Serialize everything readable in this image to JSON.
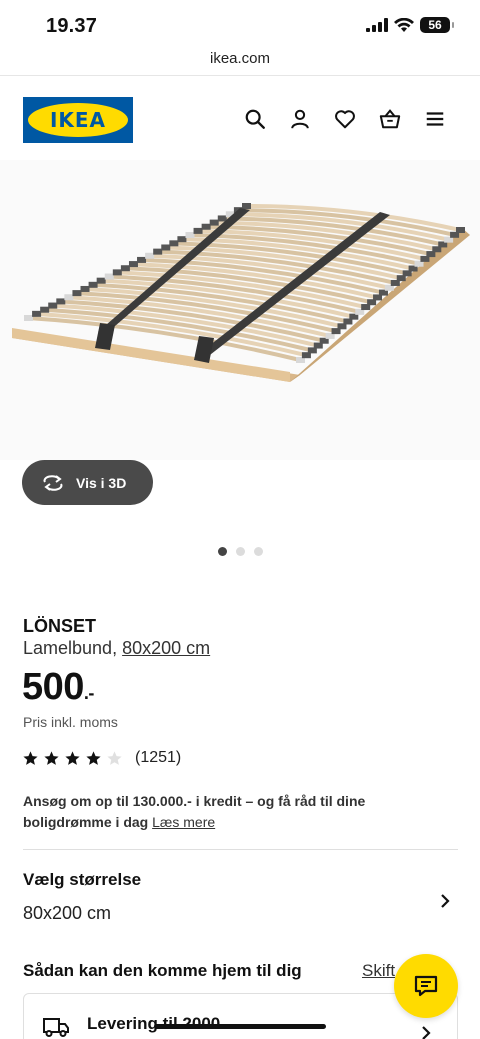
{
  "status_bar": {
    "time": "19.37",
    "battery": "56"
  },
  "url_bar": {
    "domain": "ikea.com"
  },
  "header": {
    "logo_text": "IKEA",
    "icons": [
      "search-icon",
      "user-icon",
      "heart-icon",
      "basket-icon",
      "menu-icon"
    ]
  },
  "gallery": {
    "view_3d_label": "Vis i 3D",
    "dots_total": 3,
    "active_dot": 1
  },
  "product": {
    "name": "LÖNSET",
    "description": "Lamelbund,",
    "size": "80x200 cm",
    "price": "500",
    "price_suffix": ".-",
    "price_note": "Pris inkl. moms",
    "rating_stars": 4,
    "rating_max": 5,
    "review_count": "(1251)"
  },
  "promo": {
    "text": "Ansøg om op til 130.000.- i kredit – og få råd til dine boligdrømme i dag",
    "link": "Læs mere"
  },
  "size_selector": {
    "title": "Vælg størrelse",
    "value": "80x200 cm"
  },
  "delivery": {
    "title": "Sådan kan den komme hjem til dig",
    "change_link": "Skift",
    "option_label": "Levering til 2000"
  },
  "colors": {
    "ikea_blue": "#0058a3",
    "ikea_yellow": "#ffdb00",
    "button_dark": "#4a4a4a"
  }
}
